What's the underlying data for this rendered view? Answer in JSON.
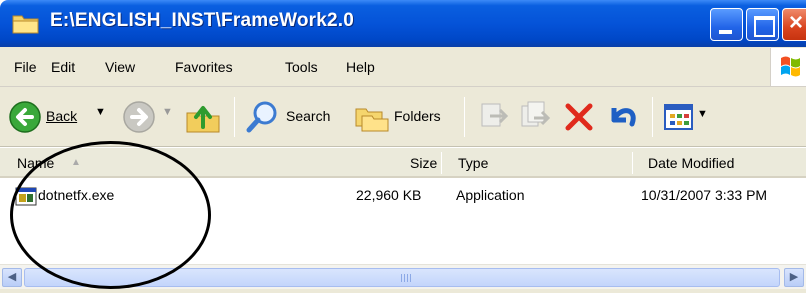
{
  "window": {
    "title": "E:\\ENGLISH_INST\\FrameWork2.0"
  },
  "menu": {
    "items": [
      "File",
      "Edit",
      "View",
      "Favorites",
      "Tools",
      "Help"
    ]
  },
  "toolbar": {
    "back_label": "Back",
    "search_label": "Search",
    "folders_label": "Folders"
  },
  "columns": {
    "name": "Name",
    "size": "Size",
    "type": "Type",
    "date": "Date Modified"
  },
  "files": [
    {
      "name": "dotnetfx.exe",
      "size": "22,960 KB",
      "type": "Application",
      "date": "10/31/2007 3:33 PM"
    }
  ],
  "colors": {
    "titlebar": "#0553d8",
    "chrome": "#ece9d8",
    "annotation": "#000000"
  }
}
